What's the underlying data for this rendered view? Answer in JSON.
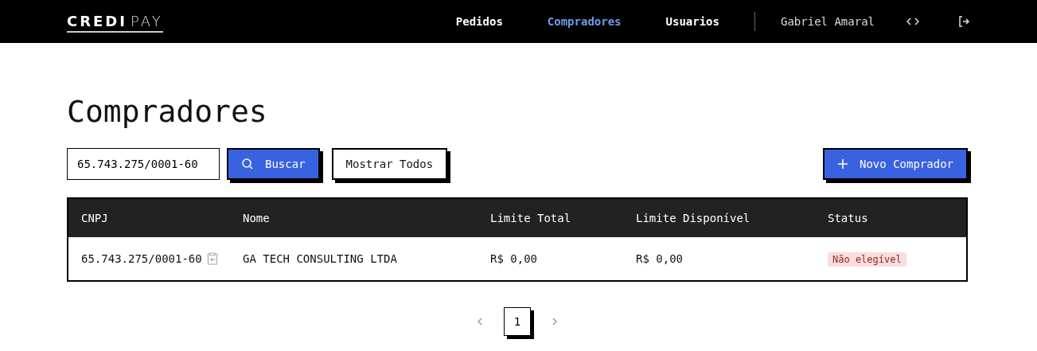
{
  "header": {
    "logo": [
      "CREDI",
      "PAY"
    ],
    "nav": [
      {
        "label": "Pedidos",
        "selected": false
      },
      {
        "label": "Compradores",
        "selected": true
      },
      {
        "label": "Usuarios",
        "selected": false
      }
    ],
    "user": "Gabriel Amaral"
  },
  "page": {
    "title": "Compradores"
  },
  "toolbar": {
    "search_value": "65.743.275/0001-60",
    "search_button": "Buscar",
    "show_all_button": "Mostrar Todos",
    "new_button": "Novo Comprador"
  },
  "table": {
    "columns": [
      "CNPJ",
      "Nome",
      "Limite Total",
      "Limite Disponível",
      "Status"
    ],
    "rows": [
      {
        "cnpj": "65.743.275/0001-60",
        "nome": "GA TECH CONSULTING LTDA",
        "limite_total": "R$ 0,00",
        "limite_disponivel": "R$ 0,00",
        "status": "Não elegível"
      }
    ]
  },
  "pagination": {
    "pages": [
      {
        "label": "1",
        "selected": true
      }
    ]
  }
}
